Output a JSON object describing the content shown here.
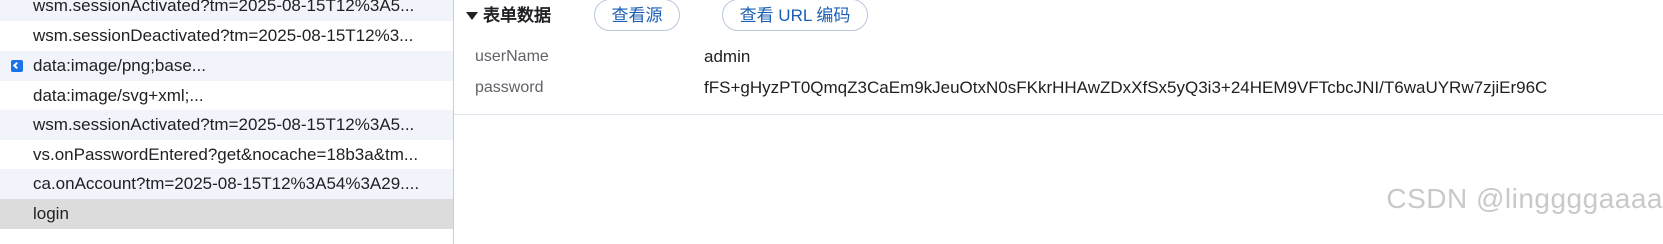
{
  "requests": [
    {
      "label": "wsm.sessionActivated?tm=2025-08-15T12%3A5...",
      "style": "alt",
      "has_icon": false
    },
    {
      "label": "wsm.sessionDeactivated?tm=2025-08-15T12%3...",
      "style": "plain",
      "has_icon": false
    },
    {
      "label": "data:image/png;base...",
      "style": "alt",
      "has_icon": true
    },
    {
      "label": "data:image/svg+xml;...",
      "style": "plain",
      "has_icon": false
    },
    {
      "label": "wsm.sessionActivated?tm=2025-08-15T12%3A5...",
      "style": "alt",
      "has_icon": false
    },
    {
      "label": "vs.onPasswordEntered?get&nocache=18b3a&tm...",
      "style": "plain",
      "has_icon": false
    },
    {
      "label": "ca.onAccount?tm=2025-08-15T12%3A54%3A29....",
      "style": "alt",
      "has_icon": false
    },
    {
      "label": "login",
      "style": "selected",
      "has_icon": false
    }
  ],
  "payload": {
    "section_title": "表单数据",
    "view_source_label": "查看源",
    "view_url_encoded_label": "查看 URL 编码",
    "fields": [
      {
        "key": "userName",
        "value": "admin"
      },
      {
        "key": "password",
        "value": "fFS+gHyzPT0QmqZ3CaEm9kJeuOtxN0sFKkrHHAwZDxXfSx5yQ3i3+24HEM9VFTcbcJNI/T6waUYRw7zjiEr96C"
      }
    ]
  },
  "watermark": "CSDN @linggggaaaa",
  "colors": {
    "accent": "#1a5fb4",
    "selected_row": "#dcdcdc",
    "alt_row": "#f1f4fb"
  }
}
